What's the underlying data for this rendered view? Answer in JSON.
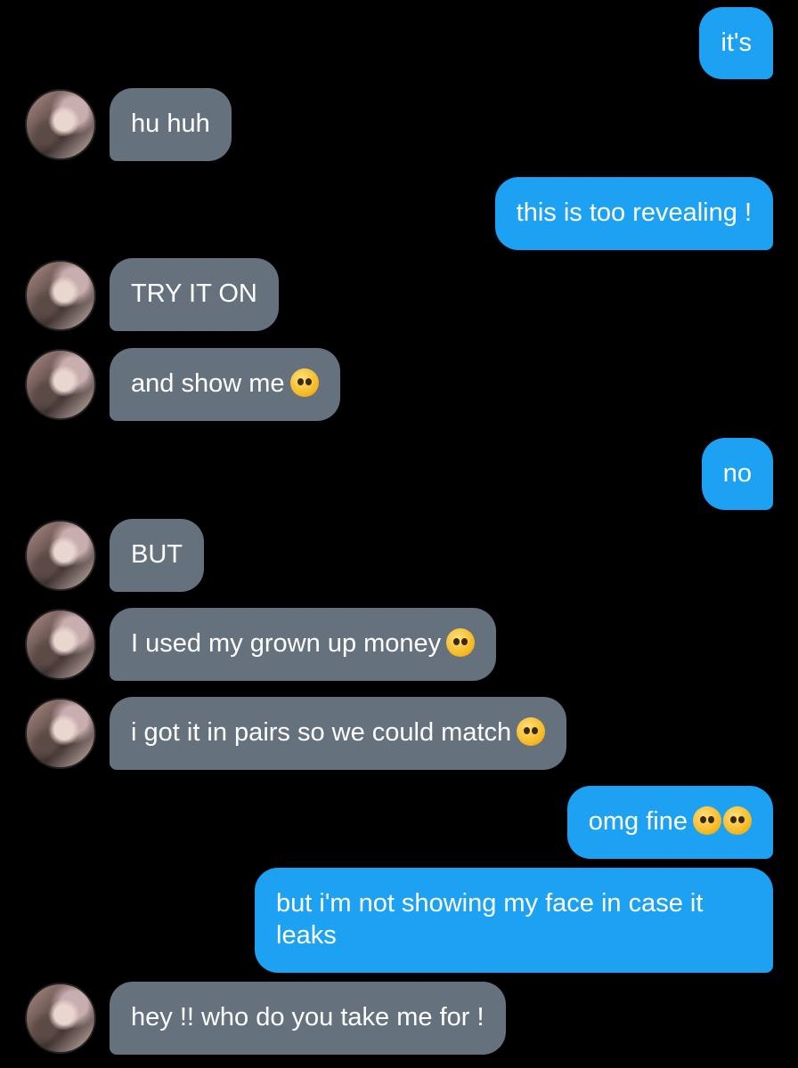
{
  "messages": [
    {
      "side": "sent",
      "text": "it's"
    },
    {
      "side": "recv",
      "text": "hu huh"
    },
    {
      "side": "sent",
      "text": "this is too revealing !"
    },
    {
      "side": "recv",
      "text": "TRY IT ON"
    },
    {
      "side": "recv",
      "text": "and show me",
      "emoji": "smirking-face-icon"
    },
    {
      "side": "sent",
      "text": "no"
    },
    {
      "side": "recv",
      "text": "BUT"
    },
    {
      "side": "recv",
      "text": "I used my grown up money",
      "emoji": "pleading-face-icon"
    },
    {
      "side": "recv",
      "text": "i got it in pairs so we could match",
      "emoji": "pleading-face-icon"
    },
    {
      "side": "sent",
      "text": "omg fine",
      "emoji": "loudly-crying-face-icon x2"
    },
    {
      "side": "sent",
      "text": "but i'm not showing my face in case it leaks"
    },
    {
      "side": "recv",
      "text": "hey !! who do you take me for !"
    }
  ],
  "colors": {
    "sent_bubble": "#1da1f2",
    "recv_bubble": "#66717e",
    "background": "#000000",
    "text": "#ffffff"
  }
}
